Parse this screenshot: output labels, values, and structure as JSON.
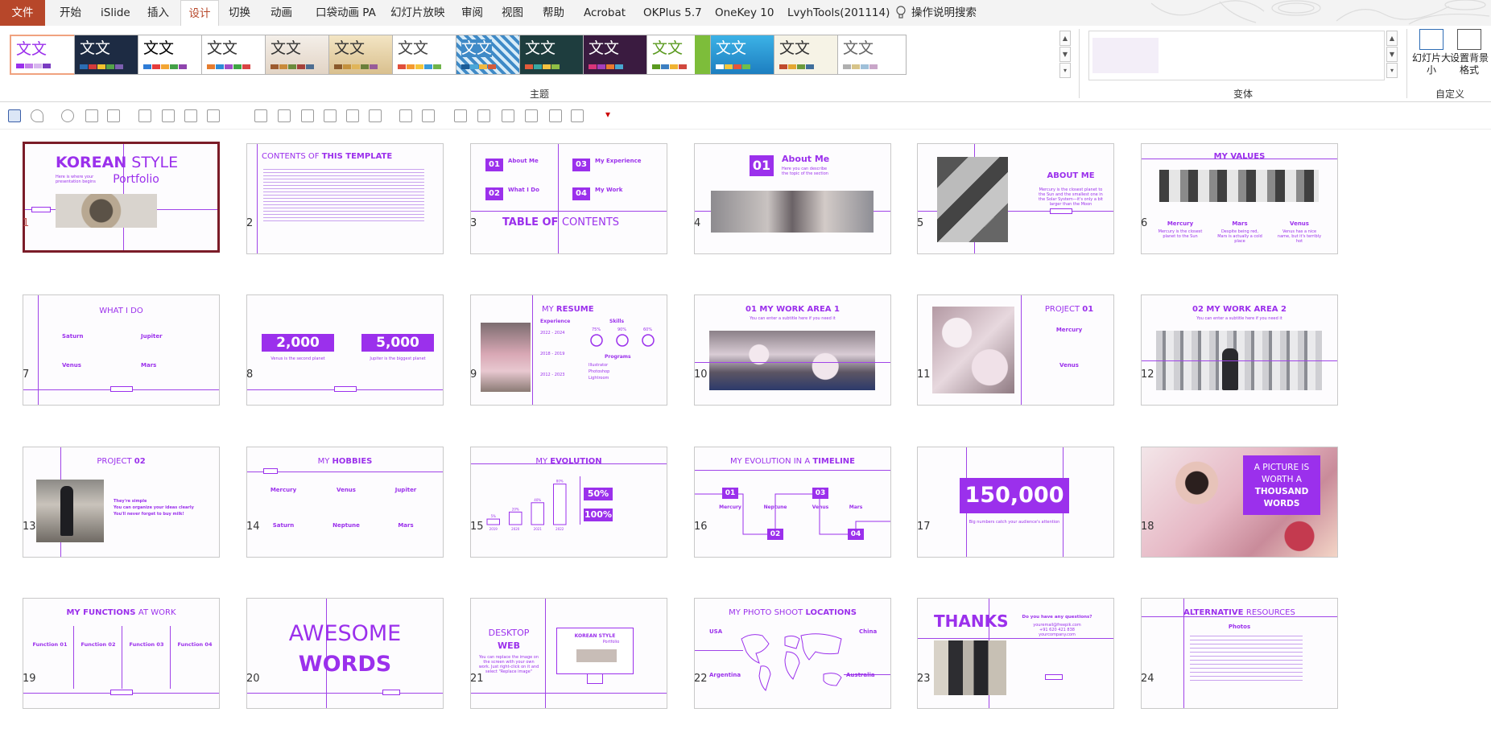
{
  "ribbon": {
    "tabs": [
      "文件",
      "开始",
      "iSlide",
      "插入",
      "设计",
      "切换",
      "动画",
      "口袋动画 PA",
      "幻灯片放映",
      "审阅",
      "视图",
      "帮助",
      "Acrobat",
      "OKPlus 5.7",
      "OneKey 10",
      "LvyhTools(201114)"
    ],
    "active_tab": "设计",
    "search_hint": "操作说明搜索",
    "theme_sample": "文文",
    "groups": {
      "themes": "主题",
      "variants": "变体",
      "customize": "自定义"
    },
    "custom_buttons": [
      "幻灯片大小",
      "设置背景格式"
    ],
    "colors": {
      "file_tab": "#b7472a",
      "accent": "#9b30ec",
      "selected_border": "#7b1c28"
    }
  },
  "slides": {
    "numbers": [
      "1",
      "2",
      "3",
      "4",
      "5",
      "6",
      "7",
      "8",
      "9",
      "10",
      "11",
      "12",
      "13",
      "14",
      "15",
      "16",
      "17",
      "18",
      "19",
      "20",
      "21",
      "22",
      "23",
      "24"
    ],
    "s1": {
      "title_a": "KOREAN",
      "title_b": " STYLE",
      "subtitle": "Portfolio",
      "text": "Here is where your presentation begins"
    },
    "s2": {
      "title_a": "CONTENTS OF ",
      "title_b": "THIS TEMPLATE"
    },
    "s3": {
      "items": [
        "About Me",
        "My Experience",
        "What I Do",
        "My Work"
      ],
      "nums": [
        "01",
        "03",
        "02",
        "04"
      ],
      "desc": "Here you can describe the topic of the section",
      "title_a": "TABLE OF ",
      "title_b": "CONTENTS"
    },
    "s4": {
      "num": "01",
      "title": "About Me",
      "desc": "Here you can describe the topic of the section"
    },
    "s5": {
      "title": "ABOUT ME",
      "text": "Mercury is the closest planet to the Sun and the smallest one in the Solar System—it's only a bit larger than the Moon"
    },
    "s6": {
      "title": "MY VALUES",
      "cols": [
        "Mercury",
        "Mars",
        "Venus"
      ],
      "texts": [
        "Mercury is the closest planet to the Sun",
        "Despite being red, Mars is actually a cold place",
        "Venus has a nice name, but it's terribly hot"
      ]
    },
    "s7": {
      "title": "WHAT I DO",
      "items": [
        "Saturn",
        "Jupiter",
        "Venus",
        "Mars"
      ]
    },
    "s8": {
      "values": [
        "2,000",
        "5,000"
      ],
      "labels": [
        "Venus is the second planet",
        "Jupiter is the biggest planet"
      ]
    },
    "s9": {
      "title_a": "MY ",
      "title_b": "RESUME",
      "heads": [
        "Experience",
        "Skills",
        "Programs"
      ],
      "years": [
        "2022 - 2024",
        "2018 - 2019",
        "2012 - 2023"
      ],
      "percents": [
        "75%",
        "90%",
        "60%"
      ],
      "programs": [
        "Illustrator",
        "Photoshop",
        "Lightroom"
      ]
    },
    "s10": {
      "title": "01 MY WORK AREA 1",
      "sub": "You can enter a subtitle here if you need it"
    },
    "s11": {
      "title_a": "PROJECT ",
      "title_b": "01",
      "items": [
        "Mercury",
        "Venus"
      ]
    },
    "s12": {
      "title": "02 MY WORK AREA 2",
      "sub": "You can enter a subtitle here if you need it"
    },
    "s13": {
      "title_a": "PROJECT ",
      "title_b": "02",
      "bullets": [
        "They're simple",
        "You can organize your ideas clearly",
        "You'll never forget to buy milk!"
      ]
    },
    "s14": {
      "title_a": "MY ",
      "title_b": "HOBBIES",
      "items": [
        "Mercury",
        "Venus",
        "Jupiter",
        "Saturn",
        "Neptune",
        "Mars"
      ]
    },
    "s15": {
      "title_a": "MY ",
      "title_b": "EVOLUTION",
      "bars": [
        {
          "year": "2019",
          "pct": "5%",
          "v": 5
        },
        {
          "year": "2020",
          "pct": "20%",
          "v": 20
        },
        {
          "year": "2021",
          "pct": "40%",
          "v": 40
        },
        {
          "year": "2022",
          "pct": "80%",
          "v": 80
        }
      ],
      "badges": [
        "50%",
        "100%"
      ]
    },
    "s16": {
      "title_a": "MY EVOLUTION IN A ",
      "title_b": "TIMELINE",
      "nums": [
        "01",
        "02",
        "03",
        "04"
      ],
      "items": [
        "Mercury",
        "Neptune",
        "Venus",
        "Mars"
      ]
    },
    "s17": {
      "value": "150,000",
      "caption": "Big numbers catch your audience's attention"
    },
    "s18": {
      "lines": [
        "A PICTURE IS",
        "WORTH A",
        "THOUSAND",
        "WORDS"
      ]
    },
    "s19": {
      "title_a": "MY FUNCTIONS ",
      "title_b": "AT WORK",
      "items": [
        "Function 01",
        "Function 02",
        "Function 03",
        "Function 04"
      ]
    },
    "s20": {
      "line1": "AWESOME",
      "line2": "WORDS"
    },
    "s21": {
      "line1": "DESKTOP",
      "line2": "WEB",
      "text": "You can replace the image on the screen with your own work. Just right-click on it and select \"Replace image\"",
      "screen_a": "KOREAN STYLE",
      "screen_b": "Portfolio"
    },
    "s22": {
      "title_a": "MY PHOTO SHOOT ",
      "title_b": "LOCATIONS",
      "places": [
        "USA",
        "China",
        "Argentina",
        "Australia"
      ]
    },
    "s23": {
      "title": "THANKS",
      "q": "Do you have any questions?",
      "email": "youremail@freepik.com",
      "phone": "+91 620 421 838",
      "site": "yourcompany.com"
    },
    "s24": {
      "title_a": "ALTERNATIVE ",
      "title_b": "RESOURCES",
      "sub": "Photos"
    }
  }
}
